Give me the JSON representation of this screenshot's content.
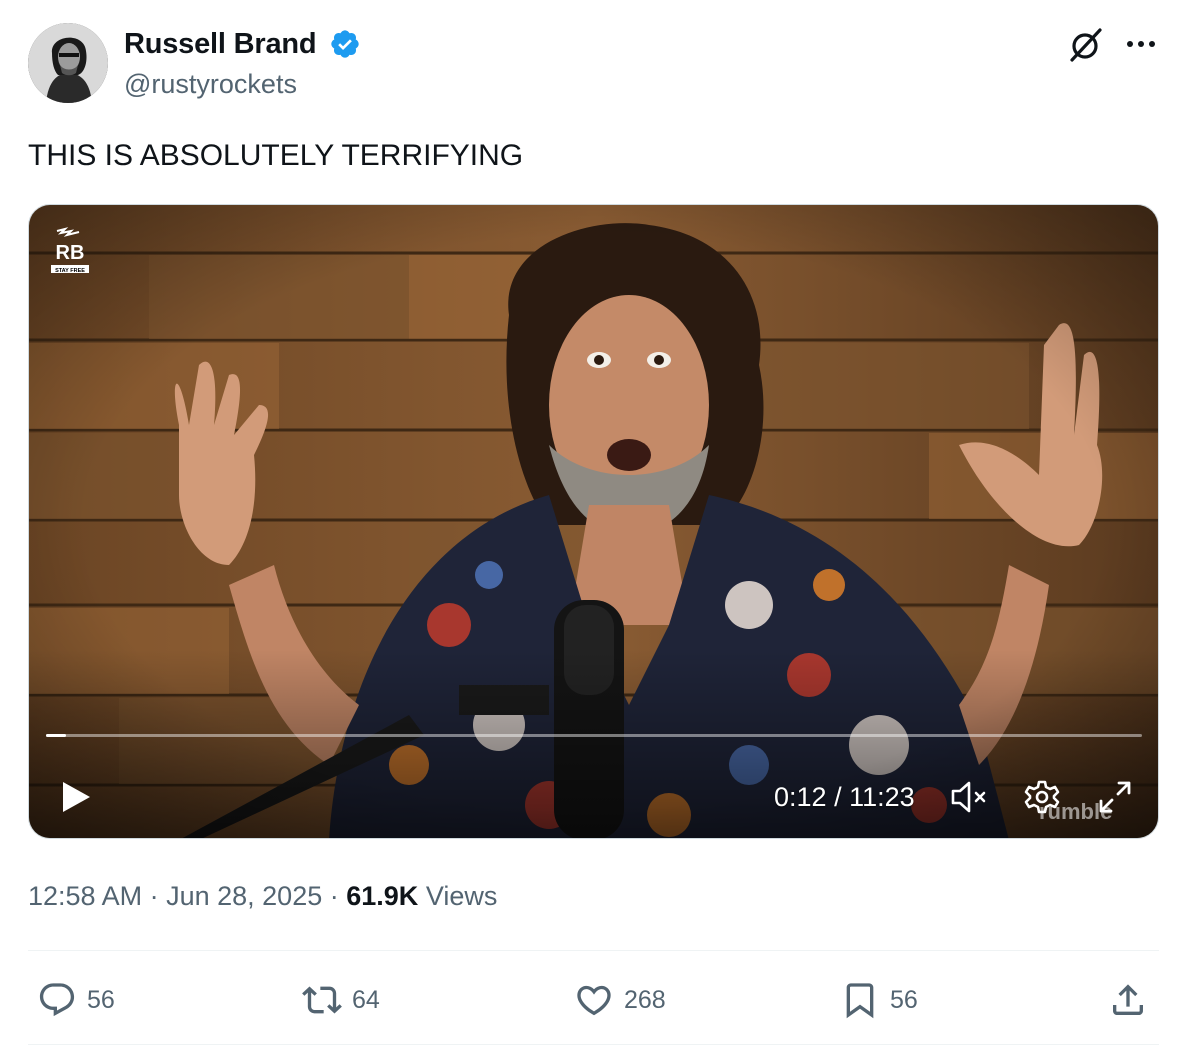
{
  "author": {
    "name": "Russell Brand",
    "handle": "@rustyrockets",
    "verified": true,
    "verified_color": "#1d9bf0"
  },
  "header_icons": [
    "grok-icon",
    "more-icon"
  ],
  "tweet": {
    "text": "THIS IS ABSOLUTELY TERRIFYING"
  },
  "video": {
    "logo_text": "RB",
    "logo_subtext": "STAY FREE",
    "current_time": "0:12",
    "separator": "/",
    "duration": "11:23",
    "progress_fraction": 0.018,
    "watermark": "rumble",
    "controls": [
      "play-icon",
      "mute-icon",
      "settings-icon",
      "fullscreen-icon"
    ]
  },
  "meta": {
    "time": "12:58 AM",
    "date": "Jun 28, 2025",
    "views_count": "61.9K",
    "views_label": "Views"
  },
  "actions": {
    "replies": "56",
    "reposts": "64",
    "likes": "268",
    "bookmarks": "56"
  }
}
